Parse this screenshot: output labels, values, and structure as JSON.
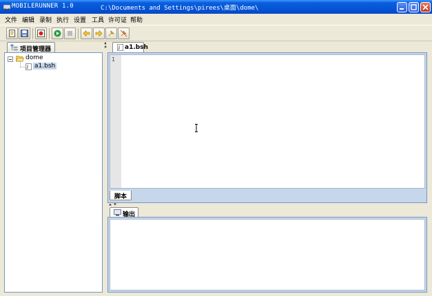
{
  "window": {
    "app_name": "MOBILERUNNER 1.0",
    "path": "C:\\Documents and Settings\\pirees\\桌面\\dome\\"
  },
  "menu": [
    "文件",
    "编辑",
    "录制",
    "执行",
    "设置",
    "工具",
    "许可证",
    "帮助"
  ],
  "toolbar": {
    "buttons": [
      "new-file",
      "save",
      "record",
      "run",
      "stop",
      "back",
      "forward",
      "mark",
      "unmark"
    ]
  },
  "project_panel": {
    "tab_label": "项目管理器",
    "tree": {
      "root": "dome",
      "children": [
        "a1.bsh"
      ],
      "selected": "a1.bsh"
    }
  },
  "editor": {
    "tab_label": "a1.bsh",
    "line_numbers": [
      "1"
    ],
    "bottom_tab": "脚本"
  },
  "output": {
    "tab_label": "输出"
  },
  "colors": {
    "titlebar": "#0553d4",
    "panel_border": "#7a96bd",
    "selection": "#c6d7ec",
    "window_bg": "#ece9d8"
  }
}
